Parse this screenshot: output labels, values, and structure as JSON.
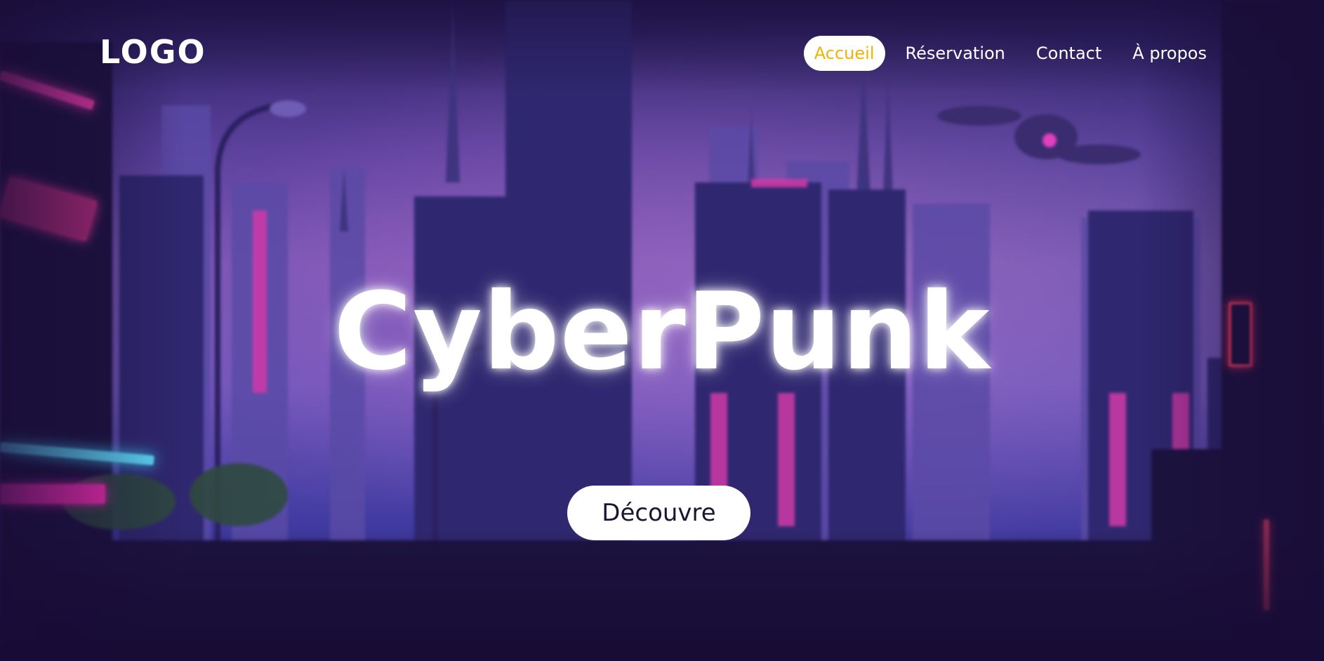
{
  "header": {
    "logo": "LOGO",
    "nav": [
      {
        "label": "Accueil",
        "active": true
      },
      {
        "label": "Réservation",
        "active": false
      },
      {
        "label": "Contact",
        "active": false
      },
      {
        "label": "À propos",
        "active": false
      }
    ]
  },
  "hero": {
    "title": "CyberPunk",
    "cta_label": "Découvre"
  },
  "colors": {
    "active_nav_text": "#f0b400",
    "background_dark": "#1e1445",
    "sky_purple": "#6a55ad",
    "neon_pink": "#ff2fb8",
    "neon_cyan": "#3fd8ff"
  }
}
